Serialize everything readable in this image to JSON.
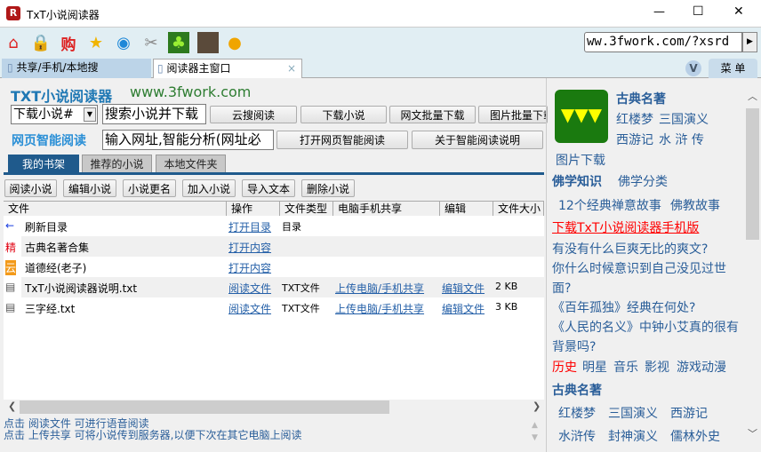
{
  "window": {
    "title": "TxT小说阅读器",
    "min": "—",
    "max": "☐",
    "close": "✕"
  },
  "toolbar": {
    "icons": [
      "home-icon",
      "lock-icon",
      "buy-icon",
      "star-icon",
      "speaker-icon",
      "tools-icon",
      "plant-icon",
      "avatar-icon",
      "chat-icon"
    ],
    "url_value": "ww.3fwork.com/?xsrd",
    "go": "▶"
  },
  "tabs": [
    {
      "label": "共享/手机/本地搜"
    },
    {
      "label": "阅读器主窗口",
      "close": "×"
    }
  ],
  "menu_label": "菜 单",
  "v_label": "V",
  "header": {
    "brand": "TXT小说阅读器",
    "site": "www.3fwork.com"
  },
  "search": {
    "select_value": "下载小说#",
    "input_value": "搜索小说并下载",
    "buttons": [
      "云搜阅读",
      "下载小说",
      "网文批量下载",
      "图片批量下载"
    ]
  },
  "smart": {
    "label": "网页智能阅读",
    "input_value": "输入网址,智能分析(网址必",
    "buttons": [
      "打开网页智能阅读",
      "关于智能阅读说明"
    ]
  },
  "panel_tabs": [
    "我的书架",
    "推荐的小说",
    "本地文件夹"
  ],
  "actions": [
    "阅读小说",
    "编辑小说",
    "小说更名",
    "加入小说",
    "导入文本",
    "删除小说"
  ],
  "table": {
    "columns": [
      "文件",
      "操作",
      "文件类型",
      "电脑手机共享",
      "编辑",
      "文件大小"
    ],
    "rows": [
      {
        "icon": "←",
        "name": "刷新目录",
        "op": "打开目录",
        "type": "目录",
        "share": "",
        "edit": "",
        "size": ""
      },
      {
        "icon": "精",
        "name": "古典名著合集",
        "op": "打开内容",
        "type": "",
        "share": "",
        "edit": "",
        "size": ""
      },
      {
        "icon": "云",
        "name": "道德经(老子)",
        "op": "打开内容",
        "type": "",
        "share": "",
        "edit": "",
        "size": ""
      },
      {
        "icon": "▤",
        "name": "TxT小说阅读器说明.txt",
        "op": "阅读文件",
        "type": "TXT文件",
        "share": "上传电脑/手机共享",
        "edit": "编辑文件",
        "size": "2 KB"
      },
      {
        "icon": "▤",
        "name": "三字经.txt",
        "op": "阅读文件",
        "type": "TXT文件",
        "share": "上传电脑/手机共享",
        "edit": "编辑文件",
        "size": "3 KB"
      }
    ]
  },
  "status": [
    "点击 阅读文件 可进行语音阅读",
    "点击 上传共享 可将小说传到服务器,以便下次在其它电脑上阅读"
  ],
  "right": {
    "classic_title": "古典名著",
    "classic_links": [
      "红楼梦",
      "三国演义",
      "西游记",
      "水 浒 传"
    ],
    "pic_download": "图片下载",
    "buddha_title": "佛学知识",
    "buddha_cat": "佛学分类",
    "buddha_links": [
      "12个经典禅意故事",
      "佛教故事"
    ],
    "mobile_download": "下载TxT小说阅读器手机版",
    "articles": [
      "有没有什么巨爽无比的爽文?",
      "你什么时候意识到自己没见过世面?",
      "《百年孤独》经典在何处?",
      "《人民的名义》中钟小艾真的很有背景吗?"
    ],
    "categories": [
      "历史",
      "明星",
      "音乐",
      "影视",
      "游戏动漫"
    ],
    "classic2_title": "古典名著",
    "classic2_links": [
      "红楼梦",
      "三国演义",
      "西游记",
      "水浒传",
      "封神演义",
      "儒林外史"
    ]
  },
  "colors": {
    "accent": "#1f5a8c",
    "link": "#2560a8",
    "red": "#ff0000"
  }
}
